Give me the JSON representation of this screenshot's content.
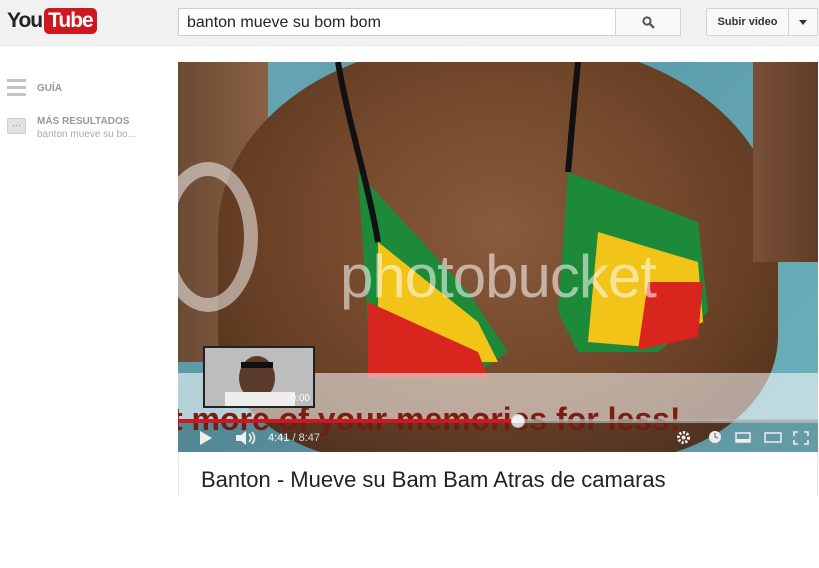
{
  "header": {
    "logo_you": "You",
    "logo_tube": "Tube",
    "search_value": "banton mueve su bom bom",
    "upload_label": "Subir video"
  },
  "sidebar": {
    "guide_label": "GUÍA",
    "more_title": "MÁS RESULTADOS",
    "more_subtitle": "banton mueve su bo...",
    "more_icon": "···"
  },
  "player": {
    "watermark": "photobucket",
    "banner": "t more of your memories for less!",
    "thumb_label": "0:00",
    "current_time": "4:41",
    "duration": "8:47",
    "progress": 0.532
  },
  "video": {
    "title": "Banton - Mueve su Bam Bam Atras de camaras"
  },
  "colors": {
    "accent": "#cc181e"
  }
}
